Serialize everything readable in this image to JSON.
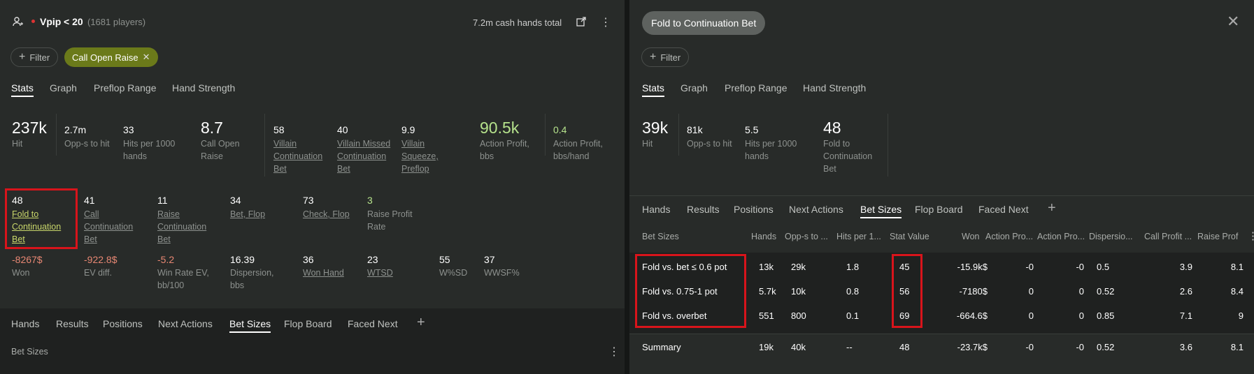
{
  "left": {
    "header": {
      "filter_name": "Vpip",
      "operator": "< 20",
      "players": "(1681 players)",
      "total": "7.2m cash hands total"
    },
    "filter_button": "Filter",
    "active_filter": "Call Open Raise",
    "tabs": [
      "Stats",
      "Graph",
      "Preflop Range",
      "Hand Strength"
    ],
    "stats_row1": [
      {
        "value": "237k",
        "label": "Hit"
      },
      {
        "value": "2.7m",
        "label": "Opp-s to hit"
      },
      {
        "value": "33",
        "label": "Hits per 1000 hands"
      },
      {
        "value": "8.7",
        "label": "Call Open Raise"
      },
      {
        "value": "58",
        "label": "Villain Continuation Bet"
      },
      {
        "value": "40",
        "label": "Villain Missed Continuation Bet"
      },
      {
        "value": "9.9",
        "label": "Villain Squeeze, Preflop"
      },
      {
        "value": "90.5k",
        "label": "Action Profit, bbs"
      },
      {
        "value": "0.4",
        "label": "Action Profit, bbs/hand"
      }
    ],
    "stats_row2": [
      {
        "value": "48",
        "label": "Fold to Continuation Bet"
      },
      {
        "value": "41",
        "label": "Call Continuation Bet"
      },
      {
        "value": "11",
        "label": "Raise Continuation Bet"
      },
      {
        "value": "34",
        "label": "Bet, Flop"
      },
      {
        "value": "73",
        "label": "Check, Flop"
      },
      {
        "value": "3",
        "label": "Raise Profit Rate"
      }
    ],
    "stats_row3": [
      {
        "value": "-8267$",
        "label": "Won"
      },
      {
        "value": "-922.8$",
        "label": "EV diff."
      },
      {
        "value": "-5.2",
        "label": "Win Rate EV, bb/100"
      },
      {
        "value": "16.39",
        "label": "Dispersion, bbs"
      },
      {
        "value": "36",
        "label": "Won Hand"
      },
      {
        "value": "23",
        "label": "WTSD"
      },
      {
        "value": "55",
        "label": "W%SD"
      },
      {
        "value": "37",
        "label": "WWSF%"
      }
    ],
    "bottom_tabs": [
      "Hands",
      "Results",
      "Positions",
      "Next Actions",
      "Bet Sizes",
      "Flop Board",
      "Faced Next"
    ],
    "bottom_label": "Bet Sizes"
  },
  "right": {
    "title": "Fold to Continuation Bet",
    "filter_button": "Filter",
    "tabs": [
      "Stats",
      "Graph",
      "Preflop Range",
      "Hand Strength"
    ],
    "stats": [
      {
        "value": "39k",
        "label": "Hit"
      },
      {
        "value": "81k",
        "label": "Opp-s to hit"
      },
      {
        "value": "5.5",
        "label": "Hits per 1000 hands"
      },
      {
        "value": "48",
        "label": "Fold to Continuation Bet"
      }
    ],
    "bottom_tabs": [
      "Hands",
      "Results",
      "Positions",
      "Next Actions",
      "Bet Sizes",
      "Flop Board",
      "Faced Next"
    ],
    "table": {
      "headers": [
        "Bet Sizes",
        "Hands",
        "Opp-s to ...",
        "Hits per 1...",
        "Stat Value",
        "Won",
        "Action Pro...",
        "Action Pro...",
        "Dispersio...",
        "Call Profit ...",
        "Raise Prof"
      ],
      "rows": [
        [
          "Fold vs. bet ≤ 0.6 pot",
          "13k",
          "29k",
          "1.8",
          "45",
          "-15.9k$",
          "-0",
          "-0",
          "0.5",
          "3.9",
          "8.1"
        ],
        [
          "Fold vs. 0.75-1 pot",
          "5.7k",
          "10k",
          "0.8",
          "56",
          "-7180$",
          "0",
          "0",
          "0.52",
          "2.6",
          "8.4"
        ],
        [
          "Fold vs. overbet",
          "551",
          "800",
          "0.1",
          "69",
          "-664.6$",
          "0",
          "0",
          "0.85",
          "7.1",
          "9"
        ]
      ],
      "summary": [
        "Summary",
        "19k",
        "40k",
        "--",
        "48",
        "-23.7k$",
        "-0",
        "-0",
        "0.52",
        "3.6",
        "8.1"
      ]
    }
  }
}
